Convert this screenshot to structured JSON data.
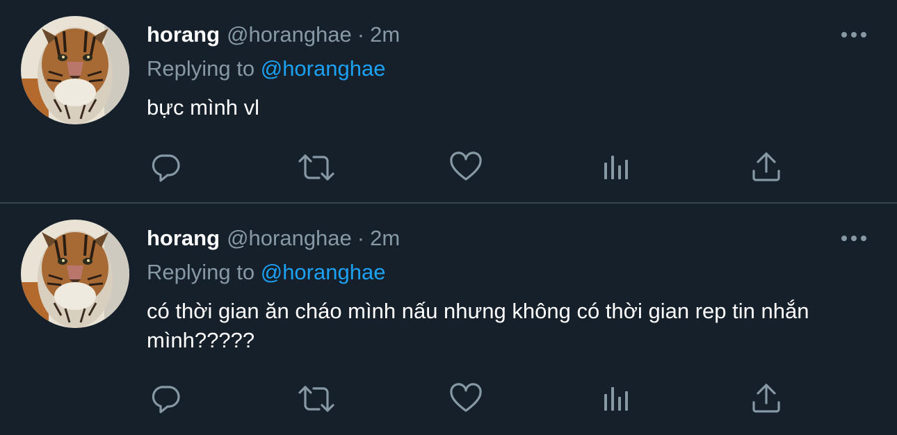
{
  "colors": {
    "background": "#15202b",
    "divider": "#38444d",
    "secondary_text": "#8899a6",
    "link": "#1da1f2",
    "primary_text": "#ffffff"
  },
  "tweets": [
    {
      "display_name": "horang",
      "handle": "@horanghae",
      "separator": "·",
      "time": "2m",
      "reply_prefix": "Replying to",
      "reply_mention": "@horanghae",
      "text": "bực mình vl",
      "avatar_icon": "tiger-avatar",
      "actions": [
        "reply-icon",
        "retweet-icon",
        "like-icon",
        "analytics-icon",
        "share-icon"
      ]
    },
    {
      "display_name": "horang",
      "handle": "@horanghae",
      "separator": "·",
      "time": "2m",
      "reply_prefix": "Replying to",
      "reply_mention": "@horanghae",
      "text": "có thời gian ăn cháo mình nấu nhưng không có thời gian rep tin nhắn mình?????",
      "avatar_icon": "tiger-avatar",
      "actions": [
        "reply-icon",
        "retweet-icon",
        "like-icon",
        "analytics-icon",
        "share-icon"
      ]
    }
  ]
}
